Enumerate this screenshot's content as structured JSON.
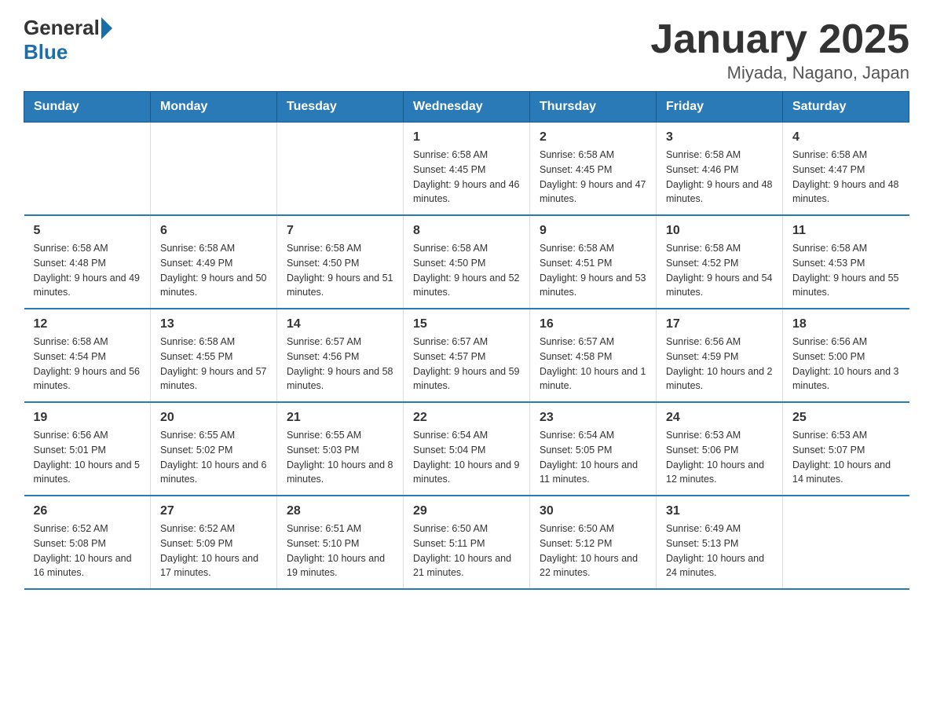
{
  "header": {
    "logo_general": "General",
    "logo_blue": "Blue",
    "title": "January 2025",
    "subtitle": "Miyada, Nagano, Japan"
  },
  "days_of_week": [
    "Sunday",
    "Monday",
    "Tuesday",
    "Wednesday",
    "Thursday",
    "Friday",
    "Saturday"
  ],
  "weeks": [
    [
      {
        "day": "",
        "info": ""
      },
      {
        "day": "",
        "info": ""
      },
      {
        "day": "",
        "info": ""
      },
      {
        "day": "1",
        "info": "Sunrise: 6:58 AM\nSunset: 4:45 PM\nDaylight: 9 hours and 46 minutes."
      },
      {
        "day": "2",
        "info": "Sunrise: 6:58 AM\nSunset: 4:45 PM\nDaylight: 9 hours and 47 minutes."
      },
      {
        "day": "3",
        "info": "Sunrise: 6:58 AM\nSunset: 4:46 PM\nDaylight: 9 hours and 48 minutes."
      },
      {
        "day": "4",
        "info": "Sunrise: 6:58 AM\nSunset: 4:47 PM\nDaylight: 9 hours and 48 minutes."
      }
    ],
    [
      {
        "day": "5",
        "info": "Sunrise: 6:58 AM\nSunset: 4:48 PM\nDaylight: 9 hours and 49 minutes."
      },
      {
        "day": "6",
        "info": "Sunrise: 6:58 AM\nSunset: 4:49 PM\nDaylight: 9 hours and 50 minutes."
      },
      {
        "day": "7",
        "info": "Sunrise: 6:58 AM\nSunset: 4:50 PM\nDaylight: 9 hours and 51 minutes."
      },
      {
        "day": "8",
        "info": "Sunrise: 6:58 AM\nSunset: 4:50 PM\nDaylight: 9 hours and 52 minutes."
      },
      {
        "day": "9",
        "info": "Sunrise: 6:58 AM\nSunset: 4:51 PM\nDaylight: 9 hours and 53 minutes."
      },
      {
        "day": "10",
        "info": "Sunrise: 6:58 AM\nSunset: 4:52 PM\nDaylight: 9 hours and 54 minutes."
      },
      {
        "day": "11",
        "info": "Sunrise: 6:58 AM\nSunset: 4:53 PM\nDaylight: 9 hours and 55 minutes."
      }
    ],
    [
      {
        "day": "12",
        "info": "Sunrise: 6:58 AM\nSunset: 4:54 PM\nDaylight: 9 hours and 56 minutes."
      },
      {
        "day": "13",
        "info": "Sunrise: 6:58 AM\nSunset: 4:55 PM\nDaylight: 9 hours and 57 minutes."
      },
      {
        "day": "14",
        "info": "Sunrise: 6:57 AM\nSunset: 4:56 PM\nDaylight: 9 hours and 58 minutes."
      },
      {
        "day": "15",
        "info": "Sunrise: 6:57 AM\nSunset: 4:57 PM\nDaylight: 9 hours and 59 minutes."
      },
      {
        "day": "16",
        "info": "Sunrise: 6:57 AM\nSunset: 4:58 PM\nDaylight: 10 hours and 1 minute."
      },
      {
        "day": "17",
        "info": "Sunrise: 6:56 AM\nSunset: 4:59 PM\nDaylight: 10 hours and 2 minutes."
      },
      {
        "day": "18",
        "info": "Sunrise: 6:56 AM\nSunset: 5:00 PM\nDaylight: 10 hours and 3 minutes."
      }
    ],
    [
      {
        "day": "19",
        "info": "Sunrise: 6:56 AM\nSunset: 5:01 PM\nDaylight: 10 hours and 5 minutes."
      },
      {
        "day": "20",
        "info": "Sunrise: 6:55 AM\nSunset: 5:02 PM\nDaylight: 10 hours and 6 minutes."
      },
      {
        "day": "21",
        "info": "Sunrise: 6:55 AM\nSunset: 5:03 PM\nDaylight: 10 hours and 8 minutes."
      },
      {
        "day": "22",
        "info": "Sunrise: 6:54 AM\nSunset: 5:04 PM\nDaylight: 10 hours and 9 minutes."
      },
      {
        "day": "23",
        "info": "Sunrise: 6:54 AM\nSunset: 5:05 PM\nDaylight: 10 hours and 11 minutes."
      },
      {
        "day": "24",
        "info": "Sunrise: 6:53 AM\nSunset: 5:06 PM\nDaylight: 10 hours and 12 minutes."
      },
      {
        "day": "25",
        "info": "Sunrise: 6:53 AM\nSunset: 5:07 PM\nDaylight: 10 hours and 14 minutes."
      }
    ],
    [
      {
        "day": "26",
        "info": "Sunrise: 6:52 AM\nSunset: 5:08 PM\nDaylight: 10 hours and 16 minutes."
      },
      {
        "day": "27",
        "info": "Sunrise: 6:52 AM\nSunset: 5:09 PM\nDaylight: 10 hours and 17 minutes."
      },
      {
        "day": "28",
        "info": "Sunrise: 6:51 AM\nSunset: 5:10 PM\nDaylight: 10 hours and 19 minutes."
      },
      {
        "day": "29",
        "info": "Sunrise: 6:50 AM\nSunset: 5:11 PM\nDaylight: 10 hours and 21 minutes."
      },
      {
        "day": "30",
        "info": "Sunrise: 6:50 AM\nSunset: 5:12 PM\nDaylight: 10 hours and 22 minutes."
      },
      {
        "day": "31",
        "info": "Sunrise: 6:49 AM\nSunset: 5:13 PM\nDaylight: 10 hours and 24 minutes."
      },
      {
        "day": "",
        "info": ""
      }
    ]
  ]
}
